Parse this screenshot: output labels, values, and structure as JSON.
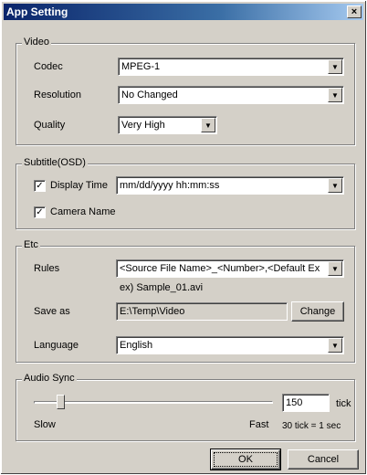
{
  "window": {
    "title": "App Setting",
    "close_glyph": "×"
  },
  "video": {
    "group_label": "Video",
    "codec_label": "Codec",
    "codec_value": "MPEG-1",
    "resolution_label": "Resolution",
    "resolution_value": "No Changed",
    "quality_label": "Quality",
    "quality_value": "Very High"
  },
  "subtitle": {
    "group_label": "Subtitle(OSD)",
    "display_time_label": "Display Time",
    "display_time_checked": true,
    "time_format_value": "mm/dd/yyyy hh:mm:ss",
    "camera_name_label": "Camera Name",
    "camera_name_checked": true
  },
  "etc": {
    "group_label": "Etc",
    "rules_label": "Rules",
    "rules_value": "<Source File Name>_<Number>,<Default Ex",
    "example_text": "ex) Sample_01.avi",
    "save_as_label": "Save as",
    "save_as_value": "E:\\Temp\\Video",
    "change_button": "Change",
    "language_label": "Language",
    "language_value": "English"
  },
  "audio_sync": {
    "group_label": "Audio Sync",
    "slow_label": "Slow",
    "fast_label": "Fast",
    "value": "150",
    "unit_label": "tick",
    "note": "30 tick = 1 sec",
    "slider_level": 0.1
  },
  "buttons": {
    "ok": "OK",
    "cancel": "Cancel"
  }
}
